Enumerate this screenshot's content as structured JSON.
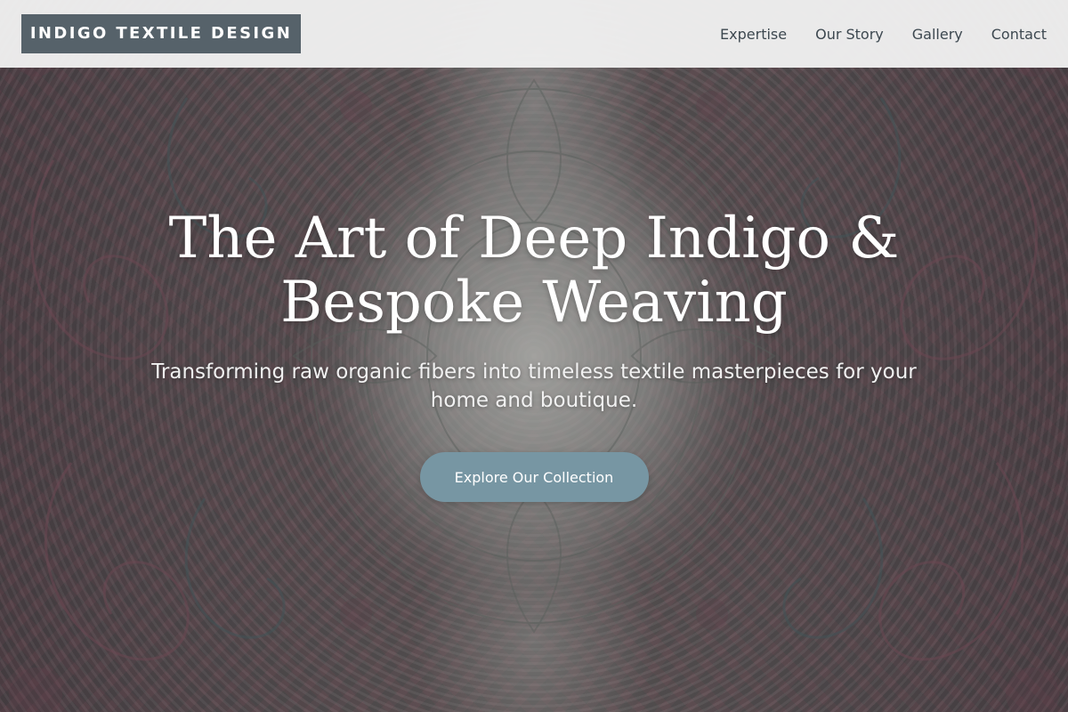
{
  "header": {
    "brand": "INDIGO TEXTILE DESIGN",
    "nav": [
      {
        "label": "Expertise"
      },
      {
        "label": "Our Story"
      },
      {
        "label": "Gallery"
      },
      {
        "label": "Contact"
      }
    ]
  },
  "hero": {
    "title_line1": "The Art of Deep Indigo &",
    "title_line2": "Bespoke Weaving",
    "subtitle": "Transforming raw organic fibers into timeless textile masterpieces for your home and boutique.",
    "cta_label": "Explore Our Collection",
    "background_image": "paisley textile pattern"
  },
  "colors": {
    "brand_bg": "#56626a",
    "header_bg": "#f0f0f0",
    "nav_text": "#3d4850",
    "cta_bg": "#7796a3",
    "hero_text": "#ffffff"
  }
}
